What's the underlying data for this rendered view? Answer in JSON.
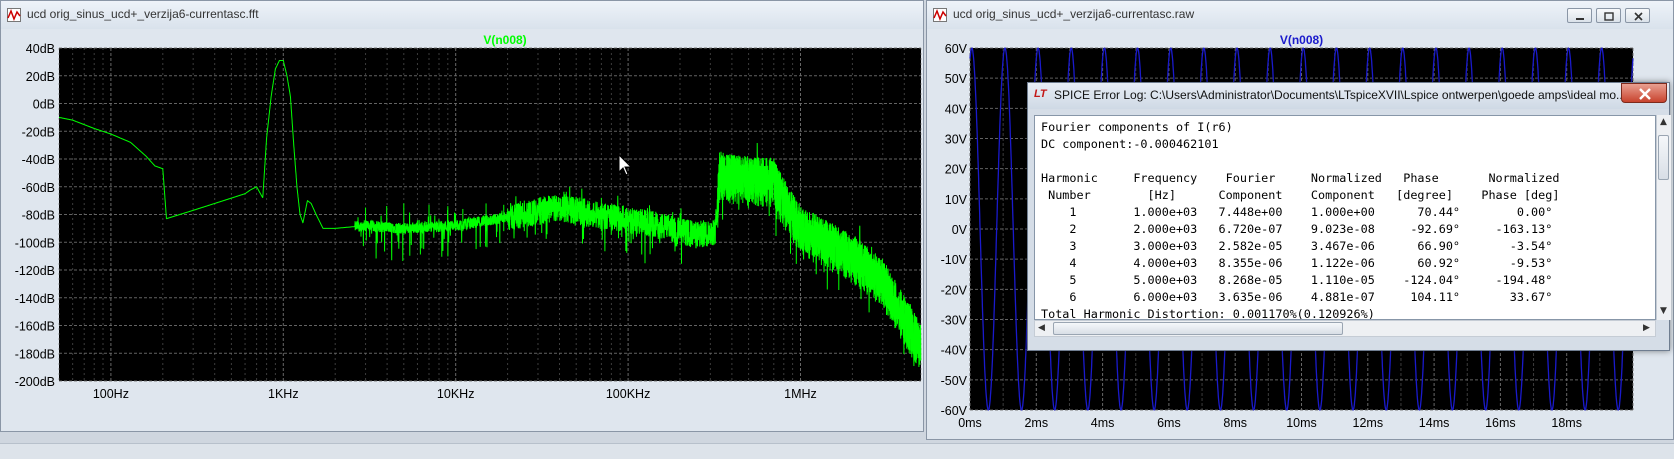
{
  "colors": {
    "plot_bg": "#000000",
    "grid": "#6e6e6e",
    "fft_trace": "#00ff00",
    "raw_trace": "#1a1acc",
    "axis_text": "#ffffff",
    "title_bar": "#dfe6ee"
  },
  "fft_window": {
    "title": "ucd orig_sinus_ucd+_verzija6-currentasc.fft",
    "trace_label": "V(n008)",
    "y_ticks": [
      "40dB",
      "20dB",
      "0dB",
      "-20dB",
      "-40dB",
      "-60dB",
      "-80dB",
      "-100dB",
      "-120dB",
      "-140dB",
      "-160dB",
      "-180dB",
      "-200dB"
    ],
    "x_ticks": [
      "100Hz",
      "1KHz",
      "10KHz",
      "100KHz",
      "1MHz"
    ],
    "icon": "waveform-icon"
  },
  "raw_window": {
    "title": "ucd orig_sinus_ucd+_verzija6-currentasc.raw",
    "trace_label": "V(n008)",
    "y_ticks": [
      "60V",
      "50V",
      "40V",
      "30V",
      "20V",
      "10V",
      "0V",
      "-10V",
      "-20V",
      "-30V",
      "-40V",
      "-50V",
      "-60V"
    ],
    "x_ticks": [
      "0ms",
      "2ms",
      "4ms",
      "6ms",
      "8ms",
      "10ms",
      "12ms",
      "14ms",
      "16ms",
      "18ms"
    ],
    "icon": "waveform-icon",
    "controls": [
      "minimize-icon",
      "restore-icon",
      "close-icon"
    ]
  },
  "error_log": {
    "logo": "LT",
    "title": "SPICE Error Log: C:\\Users\\Administrator\\Documents\\LTspiceXVII\\Lspice ontwerpen\\goede amps\\ideal mo...",
    "lines": [
      "Fourier components of I(r6)",
      "DC component:-0.000462101",
      "",
      "Harmonic     Frequency    Fourier     Normalized   Phase       Normalized",
      " Number        [Hz]      Component    Component   [degree]    Phase [deg]",
      "    1        1.000e+03   7.448e+00    1.000e+00      70.44°        0.00°",
      "    2        2.000e+03   6.720e-07    9.023e-08     -92.69°     -163.13°",
      "    3        3.000e+03   2.582e-05    3.467e-06      66.90°       -3.54°",
      "    4        4.000e+03   8.355e-06    1.122e-06      60.92°       -9.53°",
      "    5        5.000e+03   8.268e-05    1.110e-05    -124.04°     -194.48°",
      "    6        6.000e+03   3.635e-06    4.881e-07     104.11°       33.67°",
      "Total Harmonic Distortion: 0.001170%(0.120926%)"
    ]
  },
  "chart_data": [
    {
      "type": "line",
      "title": "V(n008)",
      "xlabel": "",
      "ylabel": "",
      "x_scale": "log",
      "xlim": [
        50,
        5000000
      ],
      "ylim": [
        -200,
        40
      ],
      "y_tick_step": 20,
      "grid": true,
      "series": [
        {
          "name": "V(n008)",
          "x": [
            50,
            60,
            80,
            100,
            130,
            160,
            180,
            200,
            210,
            300,
            450,
            600,
            650,
            700,
            760,
            800,
            850,
            900,
            950,
            1000,
            1050,
            1100,
            1150,
            1200,
            1250,
            1300,
            1380,
            1450,
            1550,
            1700,
            2000,
            3000,
            5000,
            10000,
            20000,
            40000,
            80000,
            150000,
            250000,
            320000,
            340000,
            400000,
            600000,
            700000,
            750000,
            1000000,
            2000000,
            3000000,
            5000000
          ],
          "y": [
            -10,
            -12,
            -18,
            -22,
            -28,
            -38,
            -45,
            -47,
            -83,
            -77,
            -70,
            -65,
            -62,
            -60,
            -68,
            -25,
            5,
            25,
            31,
            31,
            20,
            5,
            -30,
            -60,
            -80,
            -86,
            -70,
            -72,
            -80,
            -90,
            -90,
            -88,
            -90,
            -88,
            -82,
            -75,
            -82,
            -88,
            -95,
            -92,
            -50,
            -53,
            -55,
            -55,
            -64,
            -90,
            -110,
            -128,
            -175
          ]
        }
      ]
    },
    {
      "type": "line",
      "title": "V(n008)",
      "xlabel": "",
      "ylabel": "",
      "xlim": [
        0,
        20
      ],
      "ylim": [
        -60,
        60
      ],
      "y_tick_step": 10,
      "grid": true,
      "series": [
        {
          "name": "V(n008)",
          "waveform": "sine",
          "frequency_khz": 1,
          "amplitude_v": 60,
          "phase_deg": 70.44
        }
      ]
    }
  ]
}
